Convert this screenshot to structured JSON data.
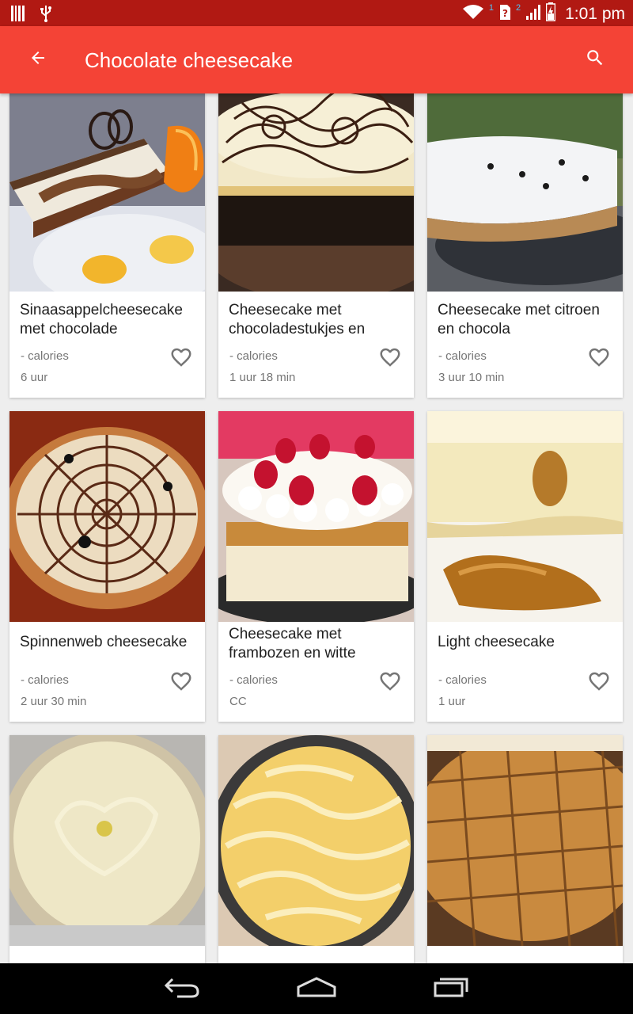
{
  "status_bar": {
    "time": "1:01 pm",
    "icons": [
      "barcode-icon",
      "usb-icon",
      "wifi-icon",
      "sim-unknown-icon",
      "cell-signal-icon",
      "battery-charging-icon"
    ],
    "sim1_label": "1",
    "sim2_label": "2"
  },
  "app_bar": {
    "title": "Chocolate cheesecake",
    "back_icon": "arrow-back-icon",
    "search_icon": "search-icon",
    "background_color": "#f44336"
  },
  "recipes": [
    {
      "title": "Sinaasappelcheesecake met chocolade",
      "calories": "- calories",
      "time": "6 uur",
      "image": "orange-chocolate-cheesecake-slice"
    },
    {
      "title": "Cheesecake met chocoladestukjes en",
      "calories": "- calories",
      "time": "1 uur 18 min",
      "image": "chocolate-drizzle-cheesecake"
    },
    {
      "title": "Cheesecake met citroen en chocola",
      "calories": "- calories",
      "time": "3 uur 10 min",
      "image": "lemon-choc-chip-cheesecake"
    },
    {
      "title": "Spinnenweb cheesecake",
      "calories": "- calories",
      "time": "2 uur 30 min",
      "image": "spiderweb-cheesecake"
    },
    {
      "title": "Cheesecake met frambozen en witte",
      "calories": "- calories",
      "time": "CC",
      "image": "raspberry-cheesecake"
    },
    {
      "title": "Light cheesecake",
      "calories": "- calories",
      "time": "1 uur",
      "image": "light-cheesecake"
    },
    {
      "title": "",
      "calories": "",
      "time": "",
      "image": "key-lime-pie"
    },
    {
      "title": "",
      "calories": "",
      "time": "",
      "image": "swirl-cheesecake"
    },
    {
      "title": "",
      "calories": "",
      "time": "",
      "image": "cheesecake-squares"
    }
  ],
  "nav_bar": {
    "back_icon": "nav-back-icon",
    "home_icon": "nav-home-icon",
    "recents_icon": "nav-recents-icon"
  }
}
